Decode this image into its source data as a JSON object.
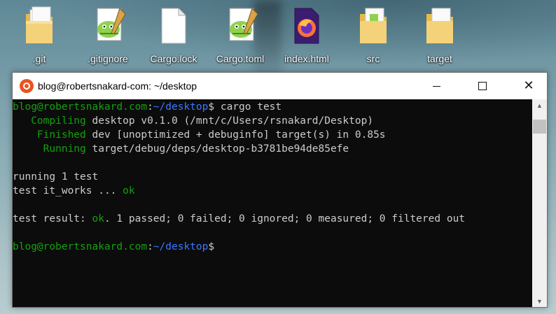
{
  "desktop": {
    "icons": [
      {
        "label": ".git",
        "type": "folder-icon"
      },
      {
        "label": ".gitignore",
        "type": "notepadpp-file-icon"
      },
      {
        "label": "Cargo.lock",
        "type": "blank-file-icon"
      },
      {
        "label": "Cargo.toml",
        "type": "notepadpp-file-icon"
      },
      {
        "label": "index.html",
        "type": "firefox-html-icon"
      },
      {
        "label": "src",
        "type": "folder-icon"
      },
      {
        "label": "target",
        "type": "folder-icon"
      }
    ]
  },
  "window": {
    "title": "blog@robertsnakard-com: ~/desktop",
    "app_icon": "ubuntu-icon",
    "controls": {
      "minimize": "minimize-icon",
      "maximize": "maximize-icon",
      "close": "close-icon"
    }
  },
  "terminal": {
    "prompt1": {
      "user": "blog@robertsnakard.com",
      "sep": ":",
      "path": "~/desktop",
      "dollar": "$",
      "command": " cargo test"
    },
    "compiling": {
      "tag": "   Compiling",
      "text": " desktop v0.1.0 (/mnt/c/Users/rsnakard/Desktop)"
    },
    "finished": {
      "tag": "    Finished",
      "text": " dev [unoptimized + debuginfo] target(s) in 0.85s"
    },
    "running": {
      "tag": "     Running",
      "text": " target/debug/deps/desktop-b3781be94de85efe"
    },
    "running_tests": "running 1 test",
    "test_line": {
      "text": "test it_works ... ",
      "status": "ok"
    },
    "result": {
      "prefix": "test result: ",
      "status": "ok",
      "text": ". 1 passed; 0 failed; 0 ignored; 0 measured; 0 filtered out"
    },
    "prompt2": {
      "user": "blog@robertsnakard.com",
      "sep": ":",
      "path": "~/desktop",
      "dollar": "$"
    }
  },
  "colors": {
    "terminal_bg": "#0c0c0c",
    "terminal_fg": "#cccccc",
    "green": "#13a10e",
    "blue": "#3b78ff",
    "ubuntu_orange": "#e95420"
  }
}
